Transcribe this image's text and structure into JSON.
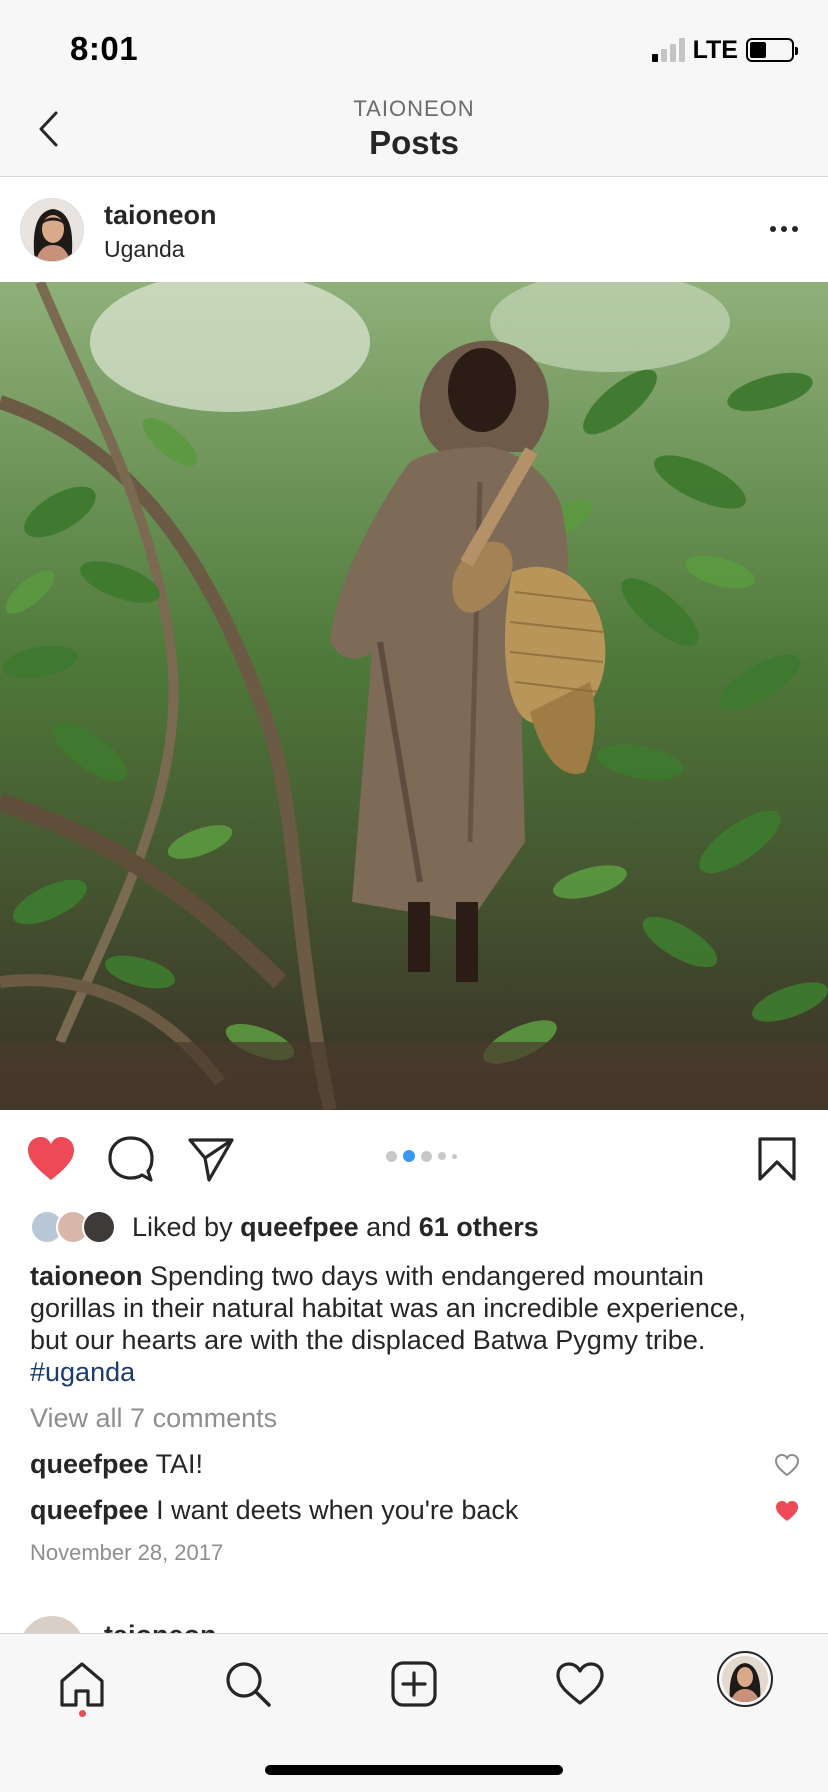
{
  "status_bar": {
    "time": "8:01",
    "network": "LTE",
    "signal_bars_on": 1,
    "signal_bars_total": 4,
    "battery_level": 0.4
  },
  "header": {
    "subtitle": "TAIONEON",
    "title": "Posts",
    "back_icon": "chevron-left-icon"
  },
  "post": {
    "username": "taioneon",
    "location": "Uganda",
    "more_icon": "ellipsis-icon",
    "photo_description_icon": "photo",
    "liked": true,
    "like_color": "#ed4956",
    "carousel_dots": 5,
    "carousel_active_index": 1,
    "carousel_active_color": "#3897f0",
    "likes": {
      "prefix": "Liked by",
      "user": "queefpee",
      "conj": "and",
      "others": "61 others"
    },
    "caption": {
      "user": "taioneon",
      "text": "Spending two days with endangered mountain gorillas in their natural habitat was an incredible experience, but our hearts are with the displaced Batwa Pygmy tribe.",
      "hashtag": "#uganda"
    },
    "view_comments": "View all 7 comments",
    "comments": [
      {
        "user": "queefpee",
        "text": "TAI!",
        "liked": false
      },
      {
        "user": "queefpee",
        "text": "I want deets when you're back",
        "liked": true
      }
    ],
    "date": "November 28, 2017"
  },
  "next_post": {
    "username": "taioneon"
  },
  "tab_bar": {
    "items": [
      "home-icon",
      "search-icon",
      "add-post-icon",
      "activity-heart-icon",
      "profile-avatar"
    ],
    "active": "home-icon"
  }
}
